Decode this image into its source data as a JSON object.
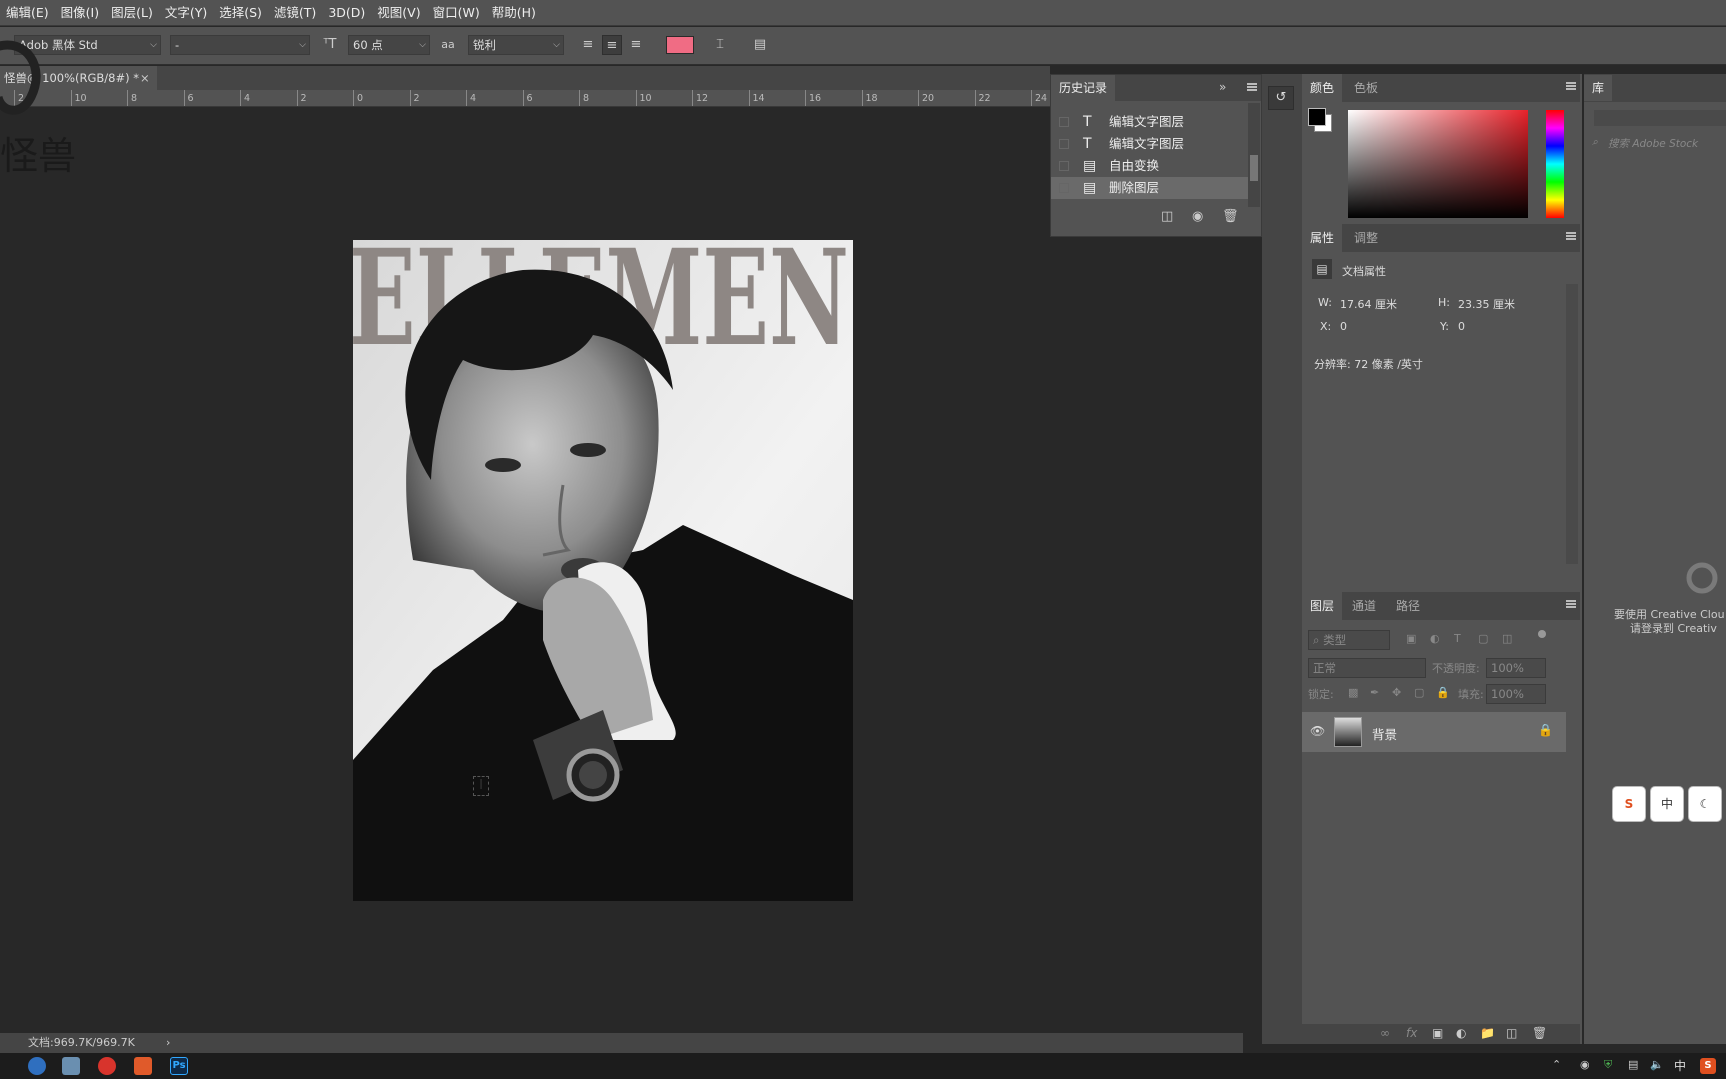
{
  "menu": [
    "编辑(E)",
    "图像(I)",
    "图层(L)",
    "文字(Y)",
    "选择(S)",
    "滤镜(T)",
    "3D(D)",
    "视图(V)",
    "窗口(W)",
    "帮助(H)"
  ],
  "options": {
    "font_family": "Adob 黑体 Std",
    "font_style": "-",
    "font_size": "60 点",
    "aa_label": "aa",
    "antialias": "锐利",
    "text_color": "#f06c84"
  },
  "document": {
    "tab_title": "怪兽@ 100%(RGB/8#) *",
    "close": "×",
    "canvas_text": "怪兽",
    "artwork_title": "ELLEMEN",
    "status": "文档:969.7K/969.7K",
    "status_arrow": "›"
  },
  "ruler": [
    "2",
    "10",
    "8",
    "6",
    "4",
    "2",
    "0",
    "2",
    "4",
    "6",
    "8",
    "10",
    "12",
    "14",
    "16",
    "18",
    "20",
    "22",
    "24"
  ],
  "history": {
    "title": "历史记录",
    "items": [
      {
        "icon": "T",
        "label": "编辑文字图层"
      },
      {
        "icon": "T",
        "label": "编辑文字图层"
      },
      {
        "icon": "doc",
        "label": "自由变换"
      },
      {
        "icon": "doc",
        "label": "删除图层"
      }
    ]
  },
  "color_panel": {
    "tabs": [
      "颜色",
      "色板"
    ],
    "foreground": "#000000",
    "background": "#ffffff",
    "hue": "#e8222a"
  },
  "properties": {
    "tabs": [
      "属性",
      "调整"
    ],
    "header": "文档属性",
    "w_label": "W:",
    "w_value": "17.64 厘米",
    "h_label": "H:",
    "h_value": "23.35 厘米",
    "x_label": "X:",
    "x_value": "0",
    "y_label": "Y:",
    "y_value": "0",
    "resolution": "分辨率: 72 像素 /英寸"
  },
  "layers": {
    "tabs": [
      "图层",
      "通道",
      "路径"
    ],
    "filter_placeholder": "类型",
    "blend_mode": "正常",
    "opacity_label": "不透明度:",
    "opacity_value": "100%",
    "lock_label": "锁定:",
    "fill_label": "填充:",
    "fill_value": "100%",
    "items": [
      {
        "name": "背景"
      }
    ]
  },
  "library": {
    "tab": "库",
    "search_placeholder": "搜索 Adobe Stock",
    "msg_line1": "要使用 Creative Clou",
    "msg_line2": "请登录到 Creativ"
  },
  "ime": [
    "S",
    "中",
    "☾"
  ]
}
